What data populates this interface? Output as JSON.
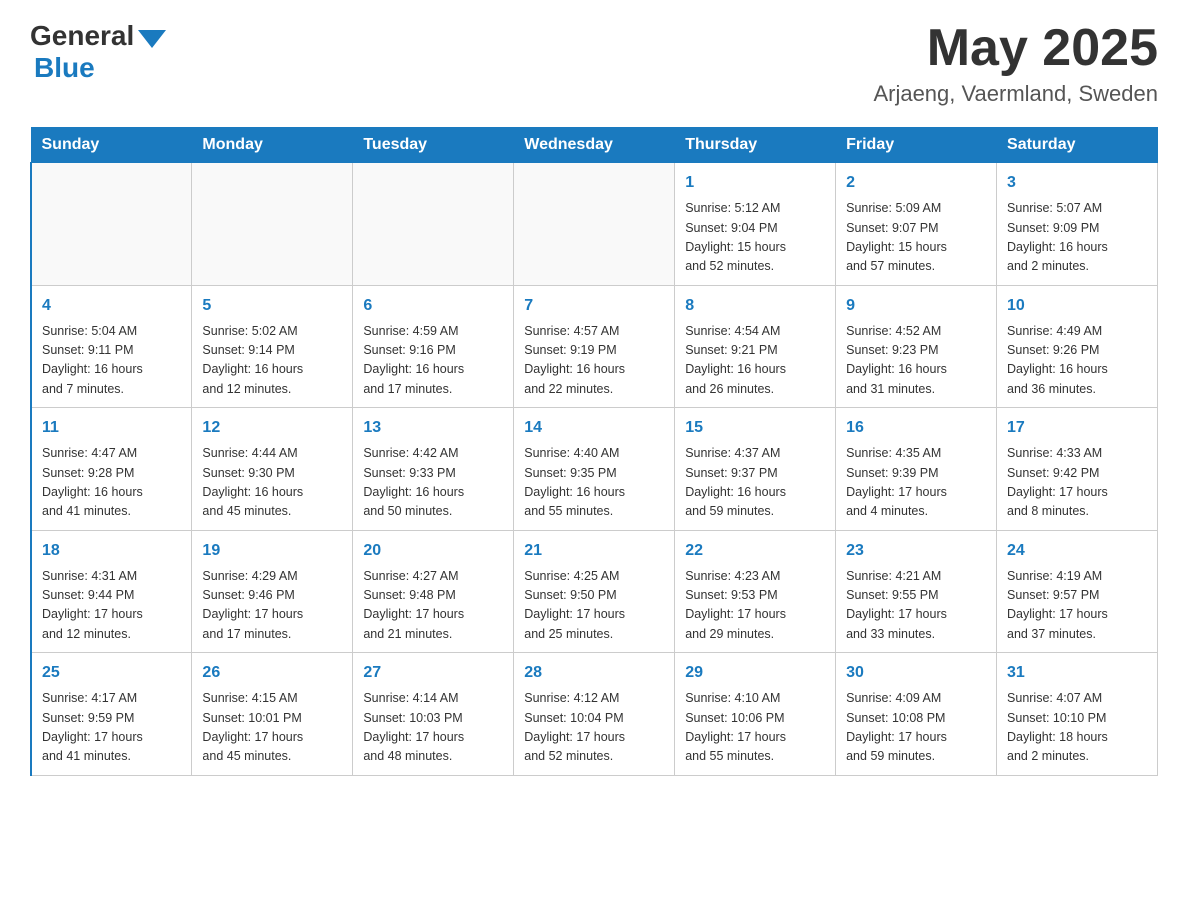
{
  "header": {
    "logo_general": "General",
    "logo_blue": "Blue",
    "month": "May 2025",
    "location": "Arjaeng, Vaermland, Sweden"
  },
  "days_of_week": [
    "Sunday",
    "Monday",
    "Tuesday",
    "Wednesday",
    "Thursday",
    "Friday",
    "Saturday"
  ],
  "weeks": [
    [
      {
        "day": "",
        "info": ""
      },
      {
        "day": "",
        "info": ""
      },
      {
        "day": "",
        "info": ""
      },
      {
        "day": "",
        "info": ""
      },
      {
        "day": "1",
        "info": "Sunrise: 5:12 AM\nSunset: 9:04 PM\nDaylight: 15 hours\nand 52 minutes."
      },
      {
        "day": "2",
        "info": "Sunrise: 5:09 AM\nSunset: 9:07 PM\nDaylight: 15 hours\nand 57 minutes."
      },
      {
        "day": "3",
        "info": "Sunrise: 5:07 AM\nSunset: 9:09 PM\nDaylight: 16 hours\nand 2 minutes."
      }
    ],
    [
      {
        "day": "4",
        "info": "Sunrise: 5:04 AM\nSunset: 9:11 PM\nDaylight: 16 hours\nand 7 minutes."
      },
      {
        "day": "5",
        "info": "Sunrise: 5:02 AM\nSunset: 9:14 PM\nDaylight: 16 hours\nand 12 minutes."
      },
      {
        "day": "6",
        "info": "Sunrise: 4:59 AM\nSunset: 9:16 PM\nDaylight: 16 hours\nand 17 minutes."
      },
      {
        "day": "7",
        "info": "Sunrise: 4:57 AM\nSunset: 9:19 PM\nDaylight: 16 hours\nand 22 minutes."
      },
      {
        "day": "8",
        "info": "Sunrise: 4:54 AM\nSunset: 9:21 PM\nDaylight: 16 hours\nand 26 minutes."
      },
      {
        "day": "9",
        "info": "Sunrise: 4:52 AM\nSunset: 9:23 PM\nDaylight: 16 hours\nand 31 minutes."
      },
      {
        "day": "10",
        "info": "Sunrise: 4:49 AM\nSunset: 9:26 PM\nDaylight: 16 hours\nand 36 minutes."
      }
    ],
    [
      {
        "day": "11",
        "info": "Sunrise: 4:47 AM\nSunset: 9:28 PM\nDaylight: 16 hours\nand 41 minutes."
      },
      {
        "day": "12",
        "info": "Sunrise: 4:44 AM\nSunset: 9:30 PM\nDaylight: 16 hours\nand 45 minutes."
      },
      {
        "day": "13",
        "info": "Sunrise: 4:42 AM\nSunset: 9:33 PM\nDaylight: 16 hours\nand 50 minutes."
      },
      {
        "day": "14",
        "info": "Sunrise: 4:40 AM\nSunset: 9:35 PM\nDaylight: 16 hours\nand 55 minutes."
      },
      {
        "day": "15",
        "info": "Sunrise: 4:37 AM\nSunset: 9:37 PM\nDaylight: 16 hours\nand 59 minutes."
      },
      {
        "day": "16",
        "info": "Sunrise: 4:35 AM\nSunset: 9:39 PM\nDaylight: 17 hours\nand 4 minutes."
      },
      {
        "day": "17",
        "info": "Sunrise: 4:33 AM\nSunset: 9:42 PM\nDaylight: 17 hours\nand 8 minutes."
      }
    ],
    [
      {
        "day": "18",
        "info": "Sunrise: 4:31 AM\nSunset: 9:44 PM\nDaylight: 17 hours\nand 12 minutes."
      },
      {
        "day": "19",
        "info": "Sunrise: 4:29 AM\nSunset: 9:46 PM\nDaylight: 17 hours\nand 17 minutes."
      },
      {
        "day": "20",
        "info": "Sunrise: 4:27 AM\nSunset: 9:48 PM\nDaylight: 17 hours\nand 21 minutes."
      },
      {
        "day": "21",
        "info": "Sunrise: 4:25 AM\nSunset: 9:50 PM\nDaylight: 17 hours\nand 25 minutes."
      },
      {
        "day": "22",
        "info": "Sunrise: 4:23 AM\nSunset: 9:53 PM\nDaylight: 17 hours\nand 29 minutes."
      },
      {
        "day": "23",
        "info": "Sunrise: 4:21 AM\nSunset: 9:55 PM\nDaylight: 17 hours\nand 33 minutes."
      },
      {
        "day": "24",
        "info": "Sunrise: 4:19 AM\nSunset: 9:57 PM\nDaylight: 17 hours\nand 37 minutes."
      }
    ],
    [
      {
        "day": "25",
        "info": "Sunrise: 4:17 AM\nSunset: 9:59 PM\nDaylight: 17 hours\nand 41 minutes."
      },
      {
        "day": "26",
        "info": "Sunrise: 4:15 AM\nSunset: 10:01 PM\nDaylight: 17 hours\nand 45 minutes."
      },
      {
        "day": "27",
        "info": "Sunrise: 4:14 AM\nSunset: 10:03 PM\nDaylight: 17 hours\nand 48 minutes."
      },
      {
        "day": "28",
        "info": "Sunrise: 4:12 AM\nSunset: 10:04 PM\nDaylight: 17 hours\nand 52 minutes."
      },
      {
        "day": "29",
        "info": "Sunrise: 4:10 AM\nSunset: 10:06 PM\nDaylight: 17 hours\nand 55 minutes."
      },
      {
        "day": "30",
        "info": "Sunrise: 4:09 AM\nSunset: 10:08 PM\nDaylight: 17 hours\nand 59 minutes."
      },
      {
        "day": "31",
        "info": "Sunrise: 4:07 AM\nSunset: 10:10 PM\nDaylight: 18 hours\nand 2 minutes."
      }
    ]
  ]
}
